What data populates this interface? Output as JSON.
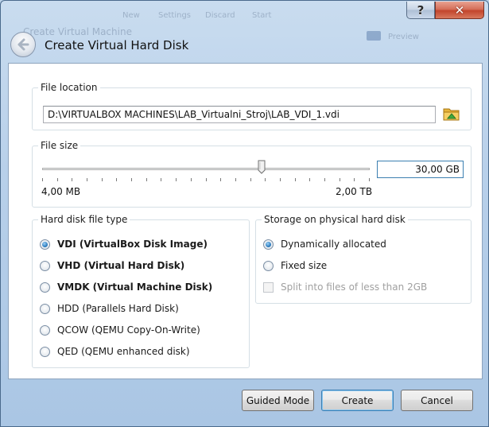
{
  "window": {
    "ghost_title": "Create Virtual Machine",
    "ghost_tabs": [
      "New",
      "Settings",
      "Discard",
      "Start"
    ],
    "ghost_right": "Preview",
    "help_symbol": "?",
    "close_symbol": "✕",
    "dialog_title": "Create Virtual Hard Disk"
  },
  "file_location": {
    "legend": "File location",
    "path": "D:\\VIRTUALBOX MACHINES\\LAB_Virtualni_Stroj\\LAB_VDI_1.vdi",
    "folder_icon": "folder-browse-icon"
  },
  "file_size": {
    "legend": "File size",
    "min_label": "4,00 MB",
    "max_label": "2,00 TB",
    "value": "30,00 GB",
    "slider_position_fraction": 0.67
  },
  "disk_type": {
    "legend": "Hard disk file type",
    "options": [
      {
        "label": "VDI (VirtualBox Disk Image)",
        "checked": true,
        "bold": true
      },
      {
        "label": "VHD (Virtual Hard Disk)",
        "checked": false,
        "bold": true
      },
      {
        "label": "VMDK (Virtual Machine Disk)",
        "checked": false,
        "bold": true
      },
      {
        "label": "HDD (Parallels Hard Disk)",
        "checked": false,
        "bold": false
      },
      {
        "label": "QCOW (QEMU Copy-On-Write)",
        "checked": false,
        "bold": false
      },
      {
        "label": "QED (QEMU enhanced disk)",
        "checked": false,
        "bold": false
      }
    ]
  },
  "storage": {
    "legend": "Storage on physical hard disk",
    "options": [
      {
        "label": "Dynamically allocated",
        "checked": true
      },
      {
        "label": "Fixed size",
        "checked": false
      }
    ],
    "split_label": "Split into files of less than 2GB",
    "split_enabled": false
  },
  "buttons": {
    "guided": "Guided Mode",
    "create": "Create",
    "cancel": "Cancel"
  }
}
